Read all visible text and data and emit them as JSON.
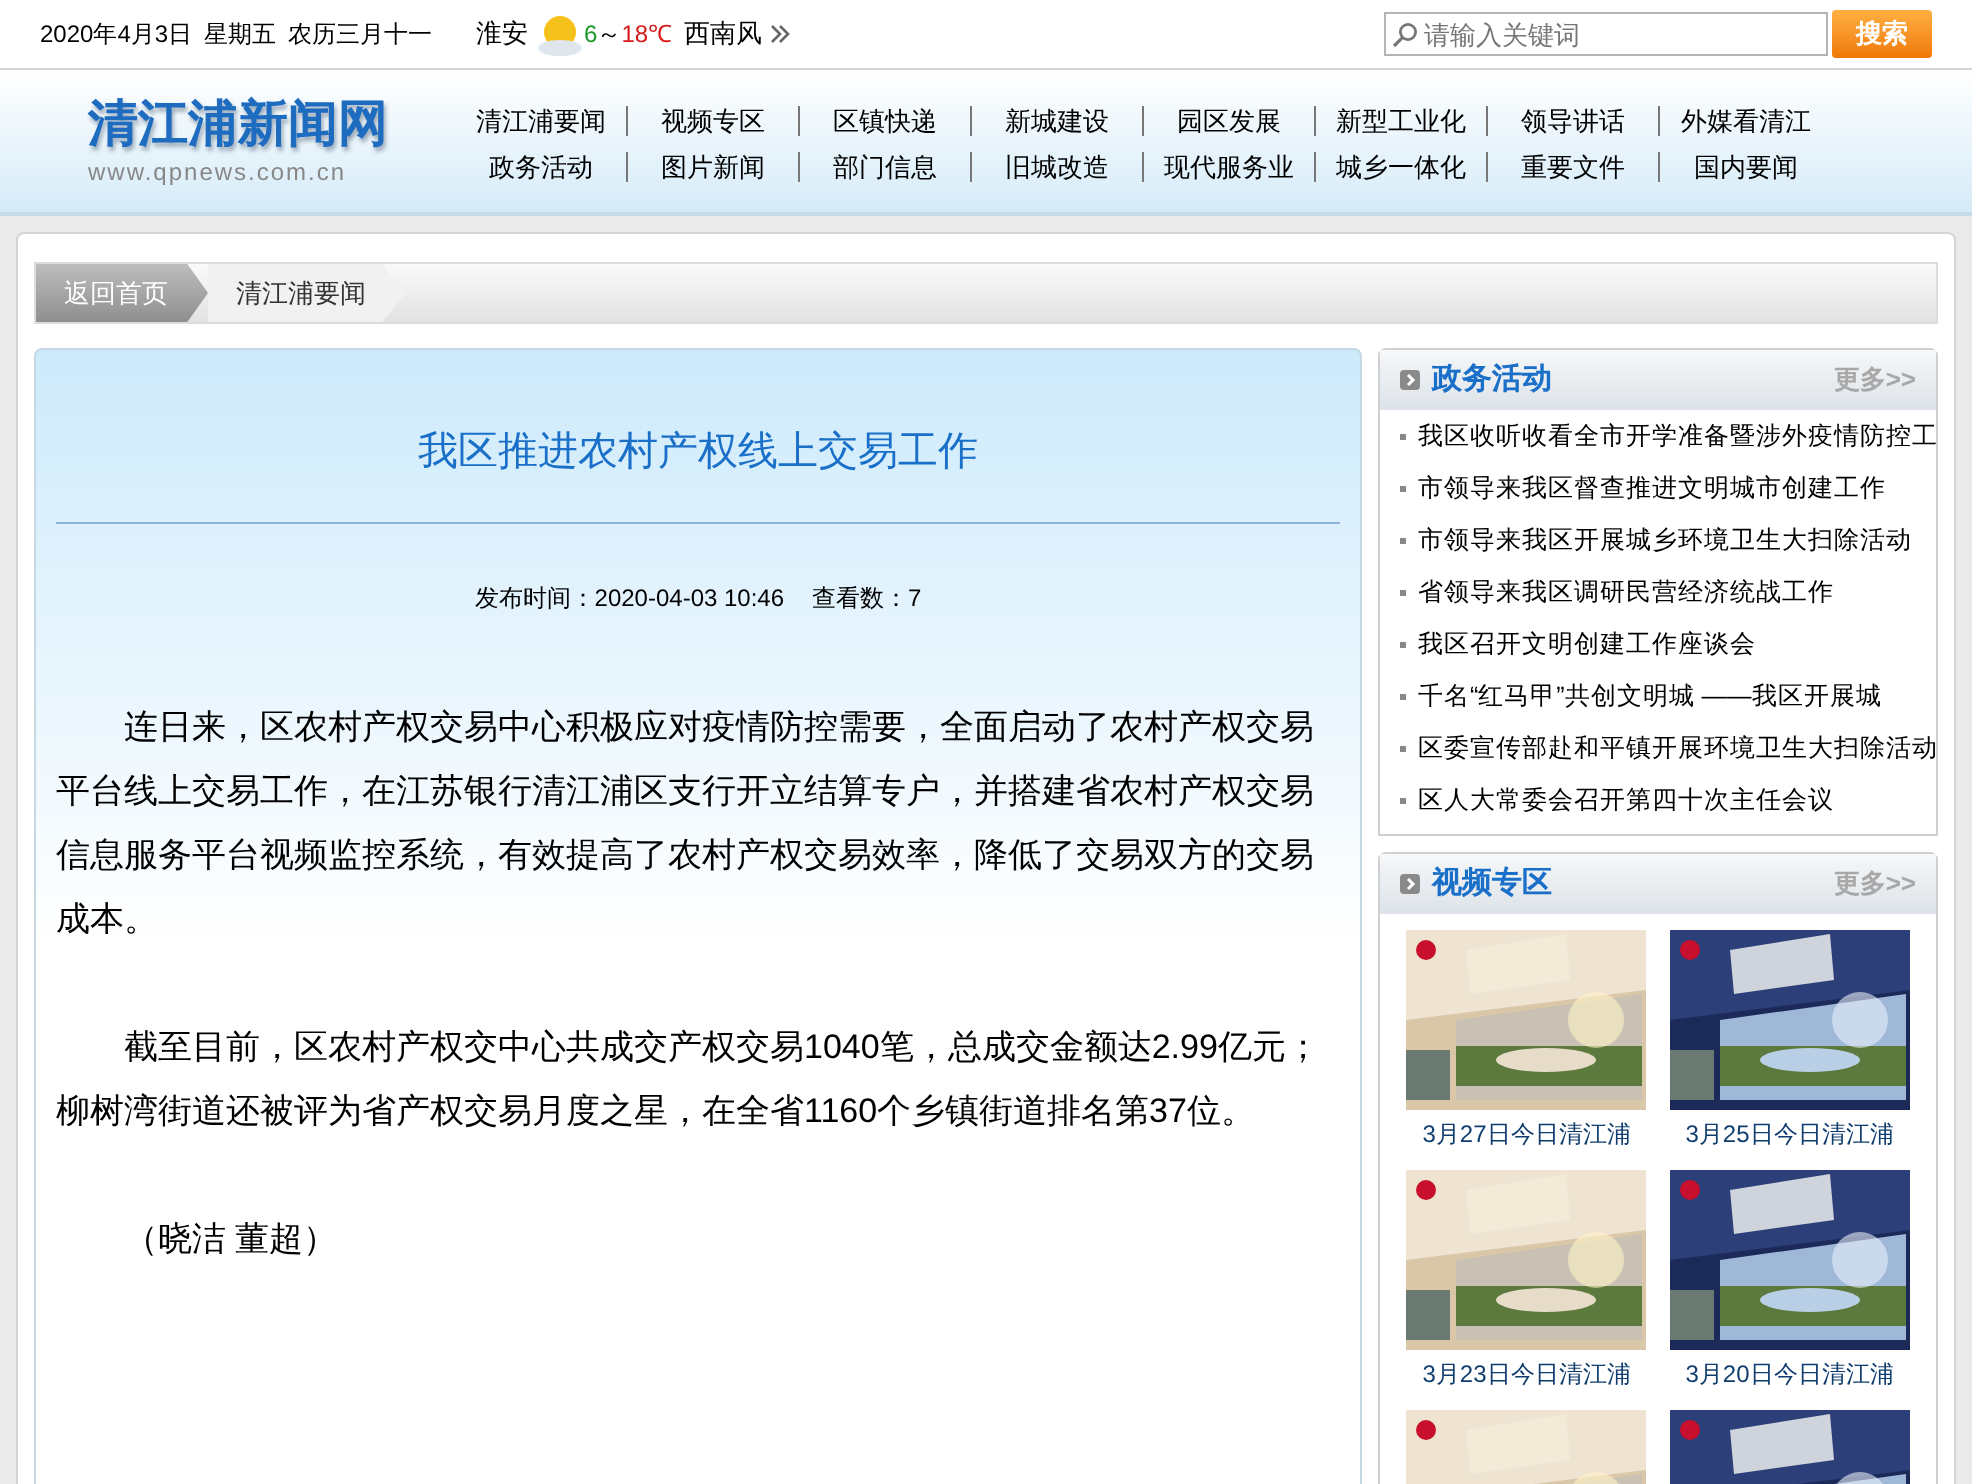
{
  "top_bar": {
    "date": "2020年4月3日",
    "weekday": "星期五",
    "lunar": "农历三月十一",
    "city": "淮安",
    "temp_low": "6",
    "temp_sep": "～",
    "temp_high": "18℃",
    "wind": "西南风",
    "search": {
      "placeholder": "请输入关键词",
      "button": "搜索"
    }
  },
  "logo": {
    "name": "清江浦新闻网",
    "url": "www.qpnews.com.cn"
  },
  "nav": [
    [
      "清江浦要闻",
      "视频专区",
      "区镇快递",
      "新城建设",
      "园区发展",
      "新型工业化",
      "领导讲话",
      "外媒看清江"
    ],
    [
      "政务活动",
      "图片新闻",
      "部门信息",
      "旧城改造",
      "现代服务业",
      "城乡一体化",
      "重要文件",
      "国内要闻"
    ]
  ],
  "breadcrumb": [
    "返回首页",
    "清江浦要闻"
  ],
  "article": {
    "title": "我区推进农村产权线上交易工作",
    "published_label": "发布时间：",
    "published": "2020-04-03 10:46",
    "views_label": "查看数：",
    "views": "7",
    "paragraphs": [
      "连日来，区农村产权交易中心积极应对疫情防控需要，全面启动了农村产权交易平台线上交易工作，在江苏银行清江浦区支行开立结算专户，并搭建省农村产权交易信息服务平台视频监控系统，有效提高了农村产权交易效率，降低了交易双方的交易成本。",
      "截至目前，区农村产权交中心共成交产权交易1040笔，总成交金额达2.99亿元；柳树湾街道还被评为省产权交易月度之星，在全省1160个乡镇街道排名第37位。",
      "（晓洁 董超）"
    ]
  },
  "sidebar": {
    "news": {
      "title": "政务活动",
      "more": "更多>>",
      "items": [
        "我区收听收看全市开学准备暨涉外疫情防控工",
        "市领导来我区督查推进文明城市创建工作",
        "市领导来我区开展城乡环境卫生大扫除活动",
        "省领导来我区调研民营经济统战工作",
        "我区召开文明创建工作座谈会",
        "千名“红马甲”共创文明城 ——我区开展城",
        "区委宣传部赴和平镇开展环境卫生大扫除活动",
        "区人大常委会召开第四十次主任会议"
      ]
    },
    "video": {
      "title": "视频专区",
      "more": "更多>>",
      "items": [
        {
          "kind": "picture",
          "caption": "3月27日今日清江浦"
        },
        {
          "kind": "picture",
          "caption": "3月25日今日清江浦"
        },
        {
          "kind": "picture",
          "caption": "3月23日今日清江浦"
        },
        {
          "kind": "picture",
          "caption": "3月20日今日清江浦"
        },
        {
          "kind": "picture"
        },
        {
          "kind": "picture"
        }
      ]
    }
  }
}
